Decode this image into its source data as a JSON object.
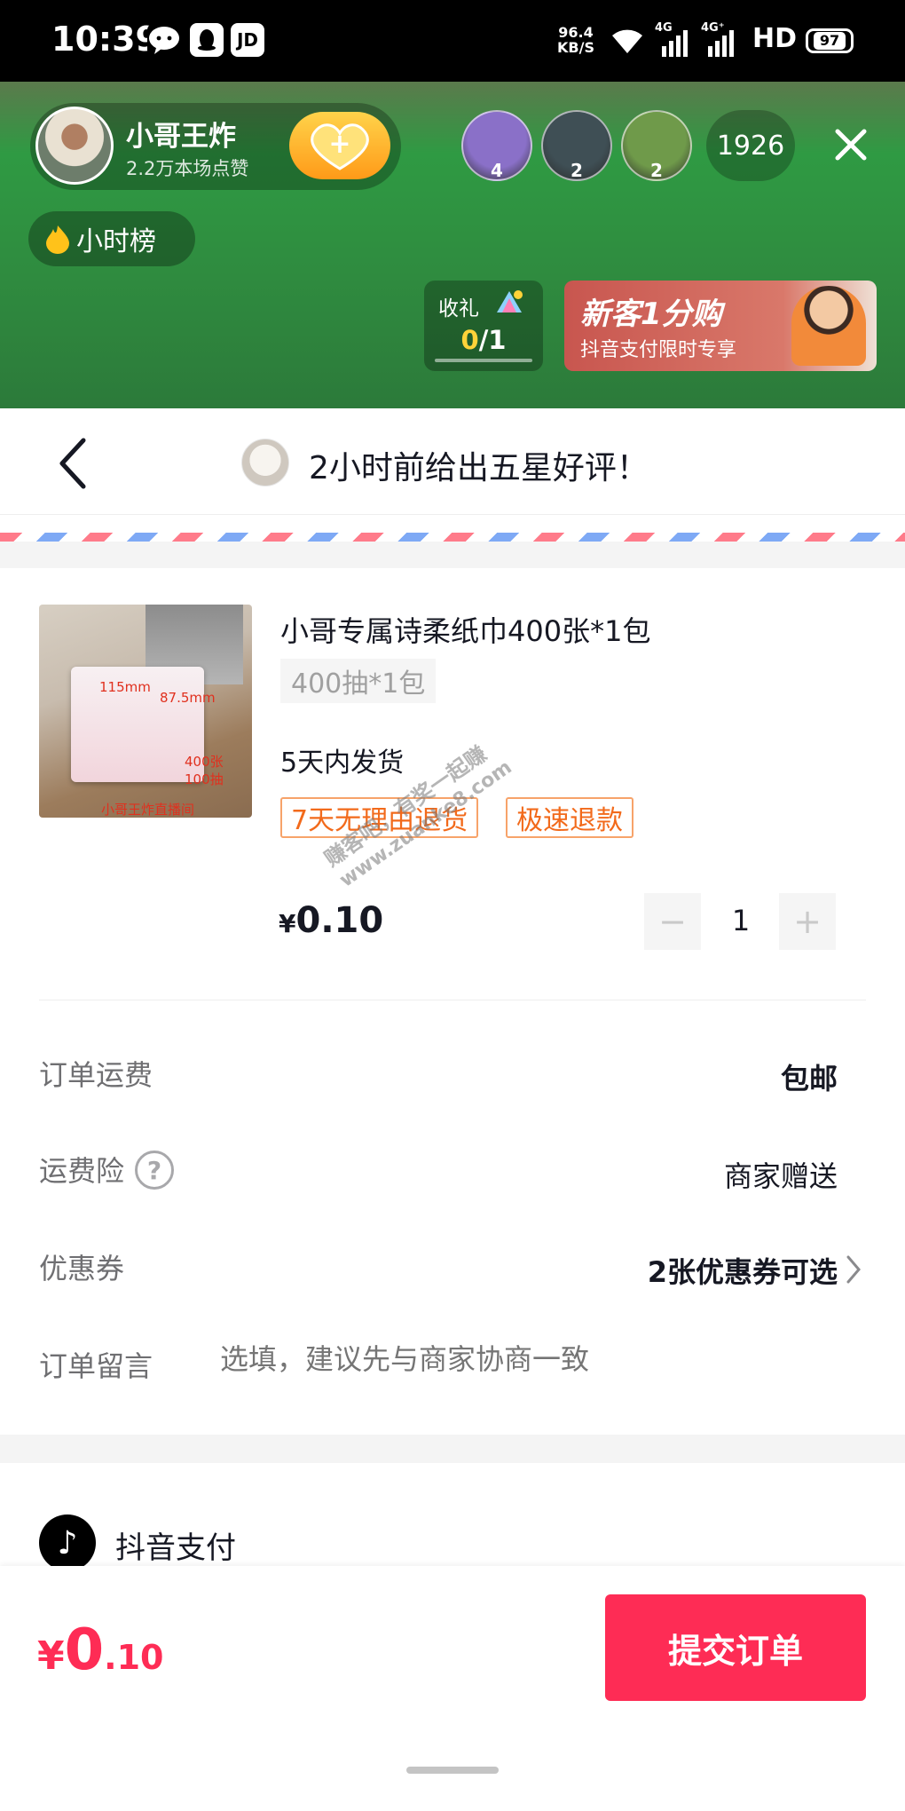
{
  "status_bar": {
    "time": "10:39",
    "app_icons": [
      "wechat-icon",
      "qq-icon",
      "jd-icon"
    ],
    "jd_label": "JD",
    "net_speed": "96.4",
    "net_speed_unit": "KB/S",
    "signal_1_label": "4G",
    "signal_2_label": "4G⁺",
    "hd_label": "HD",
    "battery": "97"
  },
  "live": {
    "anchor_name": "小哥王炸",
    "anchor_likes": "2.2万本场点赞",
    "follow_symbol": "+",
    "viewers": [
      {
        "rank": "4",
        "color": "#8a70c8"
      },
      {
        "rank": "2",
        "color": "#3f4f55"
      },
      {
        "rank": "2",
        "color": "#6f9a4a"
      }
    ],
    "viewer_count": "1926",
    "hour_rank_label": "小时榜",
    "gift_label": "收礼",
    "gift_current": "0",
    "gift_total": "/1",
    "promo_title": "新客1分购",
    "promo_subtitle": "抖音支付限时专享"
  },
  "header": {
    "review_text": "2小时前给出五星好评！"
  },
  "product": {
    "title": "小哥专属诗柔纸巾400张*1包",
    "sku": "400抽*1包",
    "ship_time": "5天内发货",
    "tags": [
      "7天无理由退货",
      "极速退款"
    ],
    "price_symbol": "¥",
    "price": "0.10",
    "quantity": "1",
    "minus": "−",
    "plus": "+",
    "image_text": [
      "115mm",
      "87.5mm",
      "400张",
      "100抽",
      "小哥王炸直播间"
    ]
  },
  "watermark": {
    "line1": "赚客吧，有奖一起赚",
    "line2": "www.zuanke8.com"
  },
  "order": {
    "freight_label": "订单运费",
    "freight_value": "包邮",
    "insurance_label": "运费险",
    "insurance_value": "商家赠送",
    "help_symbol": "?",
    "coupon_label": "优惠券",
    "coupon_value": "2张优惠券可选",
    "note_label": "订单留言",
    "note_placeholder": "选填，建议先与商家协商一致"
  },
  "payment": {
    "method": "抖音支付",
    "logo_symbol": "♪"
  },
  "bottom": {
    "total_symbol": "¥",
    "total_int": "0",
    "total_dec": ".10",
    "submit_label": "提交订单"
  },
  "colors": {
    "accent": "#fe2c55",
    "tag_orange": "#f26a1b",
    "live_green": "#2f8b3f"
  }
}
